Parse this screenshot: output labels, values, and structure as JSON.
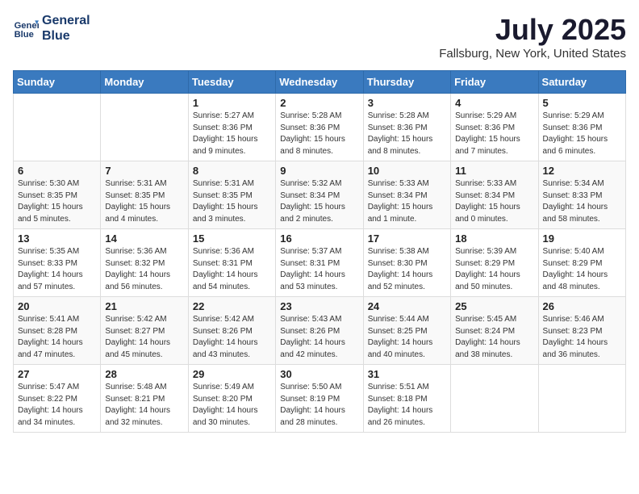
{
  "header": {
    "logo_line1": "General",
    "logo_line2": "Blue",
    "month": "July 2025",
    "location": "Fallsburg, New York, United States"
  },
  "weekdays": [
    "Sunday",
    "Monday",
    "Tuesday",
    "Wednesday",
    "Thursday",
    "Friday",
    "Saturday"
  ],
  "weeks": [
    [
      {
        "day": "",
        "sunrise": "",
        "sunset": "",
        "daylight": ""
      },
      {
        "day": "",
        "sunrise": "",
        "sunset": "",
        "daylight": ""
      },
      {
        "day": "1",
        "sunrise": "Sunrise: 5:27 AM",
        "sunset": "Sunset: 8:36 PM",
        "daylight": "Daylight: 15 hours and 9 minutes."
      },
      {
        "day": "2",
        "sunrise": "Sunrise: 5:28 AM",
        "sunset": "Sunset: 8:36 PM",
        "daylight": "Daylight: 15 hours and 8 minutes."
      },
      {
        "day": "3",
        "sunrise": "Sunrise: 5:28 AM",
        "sunset": "Sunset: 8:36 PM",
        "daylight": "Daylight: 15 hours and 8 minutes."
      },
      {
        "day": "4",
        "sunrise": "Sunrise: 5:29 AM",
        "sunset": "Sunset: 8:36 PM",
        "daylight": "Daylight: 15 hours and 7 minutes."
      },
      {
        "day": "5",
        "sunrise": "Sunrise: 5:29 AM",
        "sunset": "Sunset: 8:36 PM",
        "daylight": "Daylight: 15 hours and 6 minutes."
      }
    ],
    [
      {
        "day": "6",
        "sunrise": "Sunrise: 5:30 AM",
        "sunset": "Sunset: 8:35 PM",
        "daylight": "Daylight: 15 hours and 5 minutes."
      },
      {
        "day": "7",
        "sunrise": "Sunrise: 5:31 AM",
        "sunset": "Sunset: 8:35 PM",
        "daylight": "Daylight: 15 hours and 4 minutes."
      },
      {
        "day": "8",
        "sunrise": "Sunrise: 5:31 AM",
        "sunset": "Sunset: 8:35 PM",
        "daylight": "Daylight: 15 hours and 3 minutes."
      },
      {
        "day": "9",
        "sunrise": "Sunrise: 5:32 AM",
        "sunset": "Sunset: 8:34 PM",
        "daylight": "Daylight: 15 hours and 2 minutes."
      },
      {
        "day": "10",
        "sunrise": "Sunrise: 5:33 AM",
        "sunset": "Sunset: 8:34 PM",
        "daylight": "Daylight: 15 hours and 1 minute."
      },
      {
        "day": "11",
        "sunrise": "Sunrise: 5:33 AM",
        "sunset": "Sunset: 8:34 PM",
        "daylight": "Daylight: 15 hours and 0 minutes."
      },
      {
        "day": "12",
        "sunrise": "Sunrise: 5:34 AM",
        "sunset": "Sunset: 8:33 PM",
        "daylight": "Daylight: 14 hours and 58 minutes."
      }
    ],
    [
      {
        "day": "13",
        "sunrise": "Sunrise: 5:35 AM",
        "sunset": "Sunset: 8:33 PM",
        "daylight": "Daylight: 14 hours and 57 minutes."
      },
      {
        "day": "14",
        "sunrise": "Sunrise: 5:36 AM",
        "sunset": "Sunset: 8:32 PM",
        "daylight": "Daylight: 14 hours and 56 minutes."
      },
      {
        "day": "15",
        "sunrise": "Sunrise: 5:36 AM",
        "sunset": "Sunset: 8:31 PM",
        "daylight": "Daylight: 14 hours and 54 minutes."
      },
      {
        "day": "16",
        "sunrise": "Sunrise: 5:37 AM",
        "sunset": "Sunset: 8:31 PM",
        "daylight": "Daylight: 14 hours and 53 minutes."
      },
      {
        "day": "17",
        "sunrise": "Sunrise: 5:38 AM",
        "sunset": "Sunset: 8:30 PM",
        "daylight": "Daylight: 14 hours and 52 minutes."
      },
      {
        "day": "18",
        "sunrise": "Sunrise: 5:39 AM",
        "sunset": "Sunset: 8:29 PM",
        "daylight": "Daylight: 14 hours and 50 minutes."
      },
      {
        "day": "19",
        "sunrise": "Sunrise: 5:40 AM",
        "sunset": "Sunset: 8:29 PM",
        "daylight": "Daylight: 14 hours and 48 minutes."
      }
    ],
    [
      {
        "day": "20",
        "sunrise": "Sunrise: 5:41 AM",
        "sunset": "Sunset: 8:28 PM",
        "daylight": "Daylight: 14 hours and 47 minutes."
      },
      {
        "day": "21",
        "sunrise": "Sunrise: 5:42 AM",
        "sunset": "Sunset: 8:27 PM",
        "daylight": "Daylight: 14 hours and 45 minutes."
      },
      {
        "day": "22",
        "sunrise": "Sunrise: 5:42 AM",
        "sunset": "Sunset: 8:26 PM",
        "daylight": "Daylight: 14 hours and 43 minutes."
      },
      {
        "day": "23",
        "sunrise": "Sunrise: 5:43 AM",
        "sunset": "Sunset: 8:26 PM",
        "daylight": "Daylight: 14 hours and 42 minutes."
      },
      {
        "day": "24",
        "sunrise": "Sunrise: 5:44 AM",
        "sunset": "Sunset: 8:25 PM",
        "daylight": "Daylight: 14 hours and 40 minutes."
      },
      {
        "day": "25",
        "sunrise": "Sunrise: 5:45 AM",
        "sunset": "Sunset: 8:24 PM",
        "daylight": "Daylight: 14 hours and 38 minutes."
      },
      {
        "day": "26",
        "sunrise": "Sunrise: 5:46 AM",
        "sunset": "Sunset: 8:23 PM",
        "daylight": "Daylight: 14 hours and 36 minutes."
      }
    ],
    [
      {
        "day": "27",
        "sunrise": "Sunrise: 5:47 AM",
        "sunset": "Sunset: 8:22 PM",
        "daylight": "Daylight: 14 hours and 34 minutes."
      },
      {
        "day": "28",
        "sunrise": "Sunrise: 5:48 AM",
        "sunset": "Sunset: 8:21 PM",
        "daylight": "Daylight: 14 hours and 32 minutes."
      },
      {
        "day": "29",
        "sunrise": "Sunrise: 5:49 AM",
        "sunset": "Sunset: 8:20 PM",
        "daylight": "Daylight: 14 hours and 30 minutes."
      },
      {
        "day": "30",
        "sunrise": "Sunrise: 5:50 AM",
        "sunset": "Sunset: 8:19 PM",
        "daylight": "Daylight: 14 hours and 28 minutes."
      },
      {
        "day": "31",
        "sunrise": "Sunrise: 5:51 AM",
        "sunset": "Sunset: 8:18 PM",
        "daylight": "Daylight: 14 hours and 26 minutes."
      },
      {
        "day": "",
        "sunrise": "",
        "sunset": "",
        "daylight": ""
      },
      {
        "day": "",
        "sunrise": "",
        "sunset": "",
        "daylight": ""
      }
    ]
  ]
}
